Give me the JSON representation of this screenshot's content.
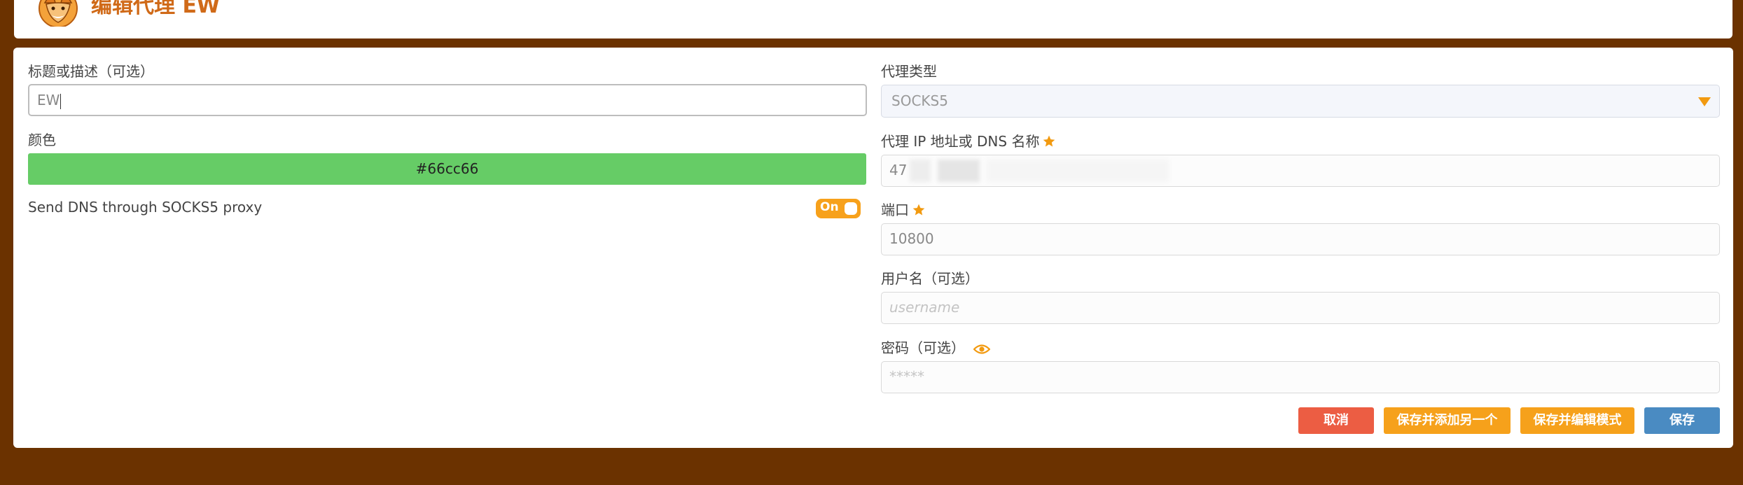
{
  "header": {
    "title": "编辑代理 EW"
  },
  "left": {
    "title_label": "标题或描述（可选）",
    "title_value": "EW",
    "color_label": "颜色",
    "color_value": "#66cc66",
    "dns_label": "Send DNS through SOCKS5 proxy",
    "dns_toggle": "On"
  },
  "right": {
    "type_label": "代理类型",
    "type_value": "SOCKS5",
    "host_label": "代理 IP 地址或 DNS 名称",
    "host_value": "47",
    "port_label": "端口",
    "port_value": "10800",
    "username_label": "用户名（可选）",
    "username_placeholder": "username",
    "password_label": "密码（可选）",
    "password_placeholder": "*****"
  },
  "buttons": {
    "cancel": "取消",
    "save_add": "保存并添加另一个",
    "save_edit": "保存并编辑模式",
    "save": "保存"
  },
  "colors": {
    "background": "#6b3200",
    "accent": "#f6a11b",
    "title": "#d06a18",
    "cancel": "#ec5d43",
    "save": "#4a8bc2",
    "proxy_color": "#66cc66"
  },
  "icons": {
    "logo": "fox-logo-icon",
    "required": "star-icon",
    "show_password": "eye-icon",
    "dropdown": "caret-down-icon"
  }
}
